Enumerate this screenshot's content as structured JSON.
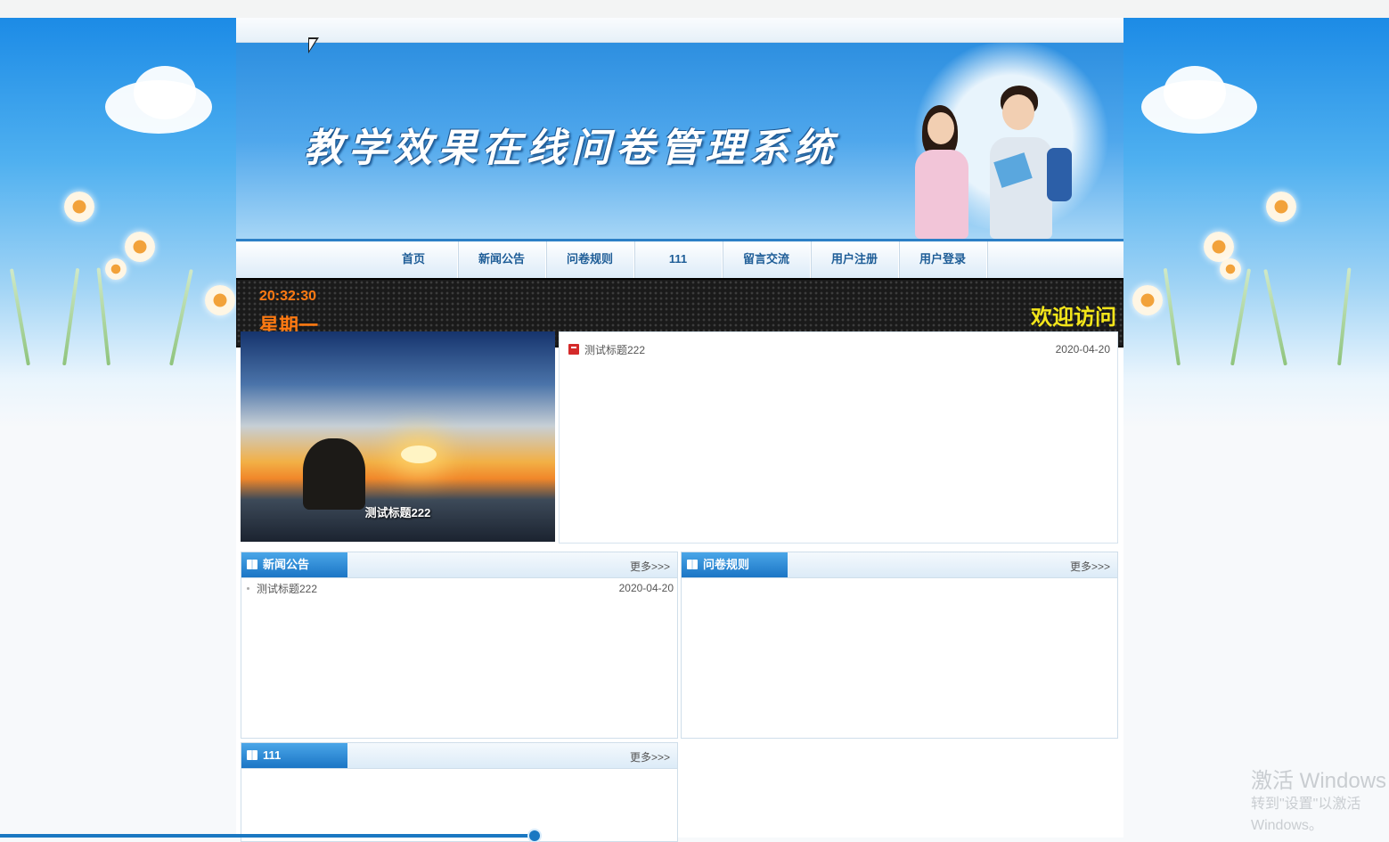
{
  "site": {
    "title": "教学效果在线问卷管理系统"
  },
  "nav": {
    "items": [
      {
        "label": "首页"
      },
      {
        "label": "新闻公告"
      },
      {
        "label": "问卷规则"
      },
      {
        "label": "111"
      },
      {
        "label": "留言交流"
      },
      {
        "label": "用户注册"
      },
      {
        "label": "用户登录"
      }
    ]
  },
  "ticker": {
    "time": "20:32:30",
    "weekday": "星期一",
    "marquee": "欢迎访问"
  },
  "slider": {
    "caption": "测试标题222"
  },
  "headline": {
    "items": [
      {
        "title": "测试标题222",
        "date": "2020-04-20"
      }
    ]
  },
  "panels": {
    "news": {
      "title": "新闻公告",
      "more": "更多>>>",
      "items": [
        {
          "title": "测试标题222",
          "date": "2020-04-20"
        }
      ]
    },
    "rules": {
      "title": "问卷规则",
      "more": "更多>>>",
      "items": []
    },
    "p111": {
      "title": "111",
      "more": "更多>>>",
      "items": []
    }
  },
  "watermark": {
    "line1": "激活 Windows",
    "line2": "转到\"设置\"以激活 Windows。"
  },
  "video_progress": {
    "fraction": 0.385
  },
  "icons": {
    "headline": "pdf-icon",
    "panel": "book-icon"
  },
  "colors": {
    "nav_text": "#1e5d97",
    "accent": "#1b75c5",
    "clock": "#ff7a12",
    "marquee": "#f3e51a"
  }
}
